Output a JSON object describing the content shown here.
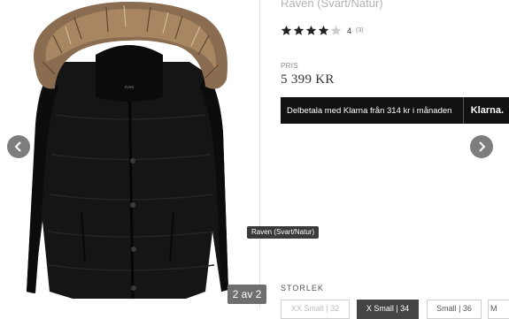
{
  "gallery": {
    "counter": "2 av 2",
    "tooltip": "Raven (Svart/Natur)",
    "brand_tag": "svea",
    "prev_icon": "chevron-left-icon",
    "next_icon": "chevron-right-icon"
  },
  "product": {
    "title": "Raven (Svart/Natur)",
    "rating": {
      "stars": 4,
      "max": 5,
      "value": "4",
      "count": "(3)"
    },
    "price_label": "PRIS",
    "price": "5 399 KR",
    "klarna": {
      "text": "Delbetala med Klarna från 314 kr i månaden",
      "logo": "Klarna."
    }
  },
  "sizes": {
    "heading": "STORLEK",
    "options": [
      "XX Small | 32",
      "X Small | 34",
      "Small | 36",
      "M"
    ],
    "selected_index": 1,
    "unavailable_index": 0
  },
  "colors": {
    "klarna_bg": "#111111",
    "nav_button": "#7d7d7d",
    "star_filled": "#222222",
    "star_empty": "#cccccc",
    "selected_size": "#444444"
  }
}
